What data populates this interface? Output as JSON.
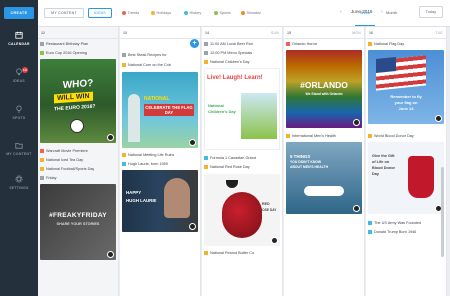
{
  "sidebar": {
    "create_label": "CREATE",
    "items": [
      {
        "label": "CALENDAR",
        "icon": "calendar-icon"
      },
      {
        "label": "IDEAS",
        "icon": "lightbulb-icon",
        "badge": "10"
      },
      {
        "label": "SPOTS",
        "icon": "pin-icon"
      },
      {
        "label": "MY CONTENT",
        "icon": "folder-icon"
      },
      {
        "label": "SETTINGS",
        "icon": "gear-icon"
      }
    ]
  },
  "toolbar": {
    "my_content": "MY CONTENT",
    "ideas": "IDEAS",
    "filters": [
      {
        "label": "Trends",
        "color": "#f0624d"
      },
      {
        "label": "Holidays",
        "color": "#f5b22b"
      },
      {
        "label": "History",
        "color": "#3dbde1"
      },
      {
        "label": "Sports",
        "color": "#8bc34a"
      },
      {
        "label": "Showbiz",
        "color": "#f08a24"
      }
    ],
    "prev": "‹",
    "month": "June 2016",
    "next": "›",
    "week": "Week",
    "month_view": "Month",
    "today": "Today"
  },
  "days": [
    {
      "num": "12",
      "name": "",
      "events": [
        {
          "text": "Restaurant Birthday Plan",
          "color": "#9aa3ac"
        },
        {
          "text": "Euro Cup 2016 Opening",
          "color": "#8bc34a"
        }
      ],
      "cards": [
        {
          "lines": [
            "WHO?",
            "WILL WIN",
            "THE EURO 2016?"
          ]
        }
      ],
      "events2": [
        {
          "text": "Warcraft Movie Premiere",
          "color": "#f0624d"
        },
        {
          "text": "National Iced Tea Day",
          "color": "#f5b22b"
        },
        {
          "text": "National Football/Sports Day",
          "color": "#f5b22b"
        },
        {
          "text": "Friday",
          "color": "#9aa3ac"
        }
      ],
      "cards2": [
        {
          "lines": [
            "#FREAKYFRIDAY",
            "SHARE YOUR STORIES"
          ]
        }
      ]
    },
    {
      "num": "13",
      "name": "",
      "events": [
        {
          "text": "Best Steak Recipes for",
          "color": "#9aa3ac"
        },
        {
          "text": "National Corn on the Cob",
          "color": "#f5b22b"
        }
      ],
      "cards": [
        {
          "lines": [
            "NATIONAL",
            "CELEBRATE THE FLAG DAY"
          ]
        }
      ],
      "events2": [
        {
          "text": "National Meeting Life Ruins",
          "color": "#f5b22b"
        },
        {
          "text": "Hugh Laurie, born 1959",
          "color": "#3dbde1"
        }
      ],
      "cards2": [
        {
          "lines": [
            "HAPPY",
            "HUGH LAURIE"
          ]
        }
      ]
    },
    {
      "num": "14",
      "name": "SUN",
      "events": [
        {
          "text": "11:00 AM Local Beer Run",
          "color": "#9aa3ac"
        },
        {
          "text": "12:00 PM Menu Specials",
          "color": "#9aa3ac"
        },
        {
          "text": "National Children's Day",
          "color": "#f5b22b"
        }
      ],
      "cards": [
        {
          "lines": [
            "Live! Laugh! Learn!",
            "National",
            "Children's Day"
          ]
        }
      ],
      "events2": [
        {
          "text": "Formula 1 Canadian Grand",
          "color": "#3dbde1"
        },
        {
          "text": "National Red Rose Day",
          "color": "#f5b22b"
        }
      ],
      "cards2": [
        {
          "lines": [
            "RED",
            "ROSE DAY"
          ]
        }
      ],
      "events3": [
        {
          "text": "National Peanut Butter Co",
          "color": "#f5b22b"
        }
      ]
    },
    {
      "num": "15",
      "name": "MON",
      "events": [
        {
          "text": "Orlando Horror",
          "color": "#f0624d"
        }
      ],
      "cards": [
        {
          "lines": [
            "#ORLANDO",
            "We Stand with Orlando"
          ]
        }
      ],
      "events2": [
        {
          "text": "International Men's Health",
          "color": "#f5b22b"
        }
      ],
      "cards2": [
        {
          "lines": [
            "5 THINGS",
            "YOU DIDN'T KNOW",
            "ABOUT MEN'S HEALTH"
          ]
        }
      ]
    },
    {
      "num": "16",
      "name": "TUE",
      "events": [
        {
          "text": "National Flag Day",
          "color": "#f5b22b"
        }
      ],
      "cards": [
        {
          "lines": [
            "Remember to fly",
            "your flag on",
            "June 14"
          ]
        }
      ],
      "events2": [
        {
          "text": "World Blood Donor Day",
          "color": "#f5b22b"
        }
      ],
      "cards2": [
        {
          "lines": [
            "Give the Gift",
            "of Life on",
            "Blood Donor",
            "Day"
          ]
        }
      ],
      "events3": [
        {
          "text": "The US Army Was Founded",
          "color": "#3dbde1"
        },
        {
          "text": "Donald Trump Born 1946",
          "color": "#3dbde1"
        }
      ]
    }
  ],
  "colors": {
    "accent": "#2b96e3",
    "sidebar": "#24303c"
  }
}
